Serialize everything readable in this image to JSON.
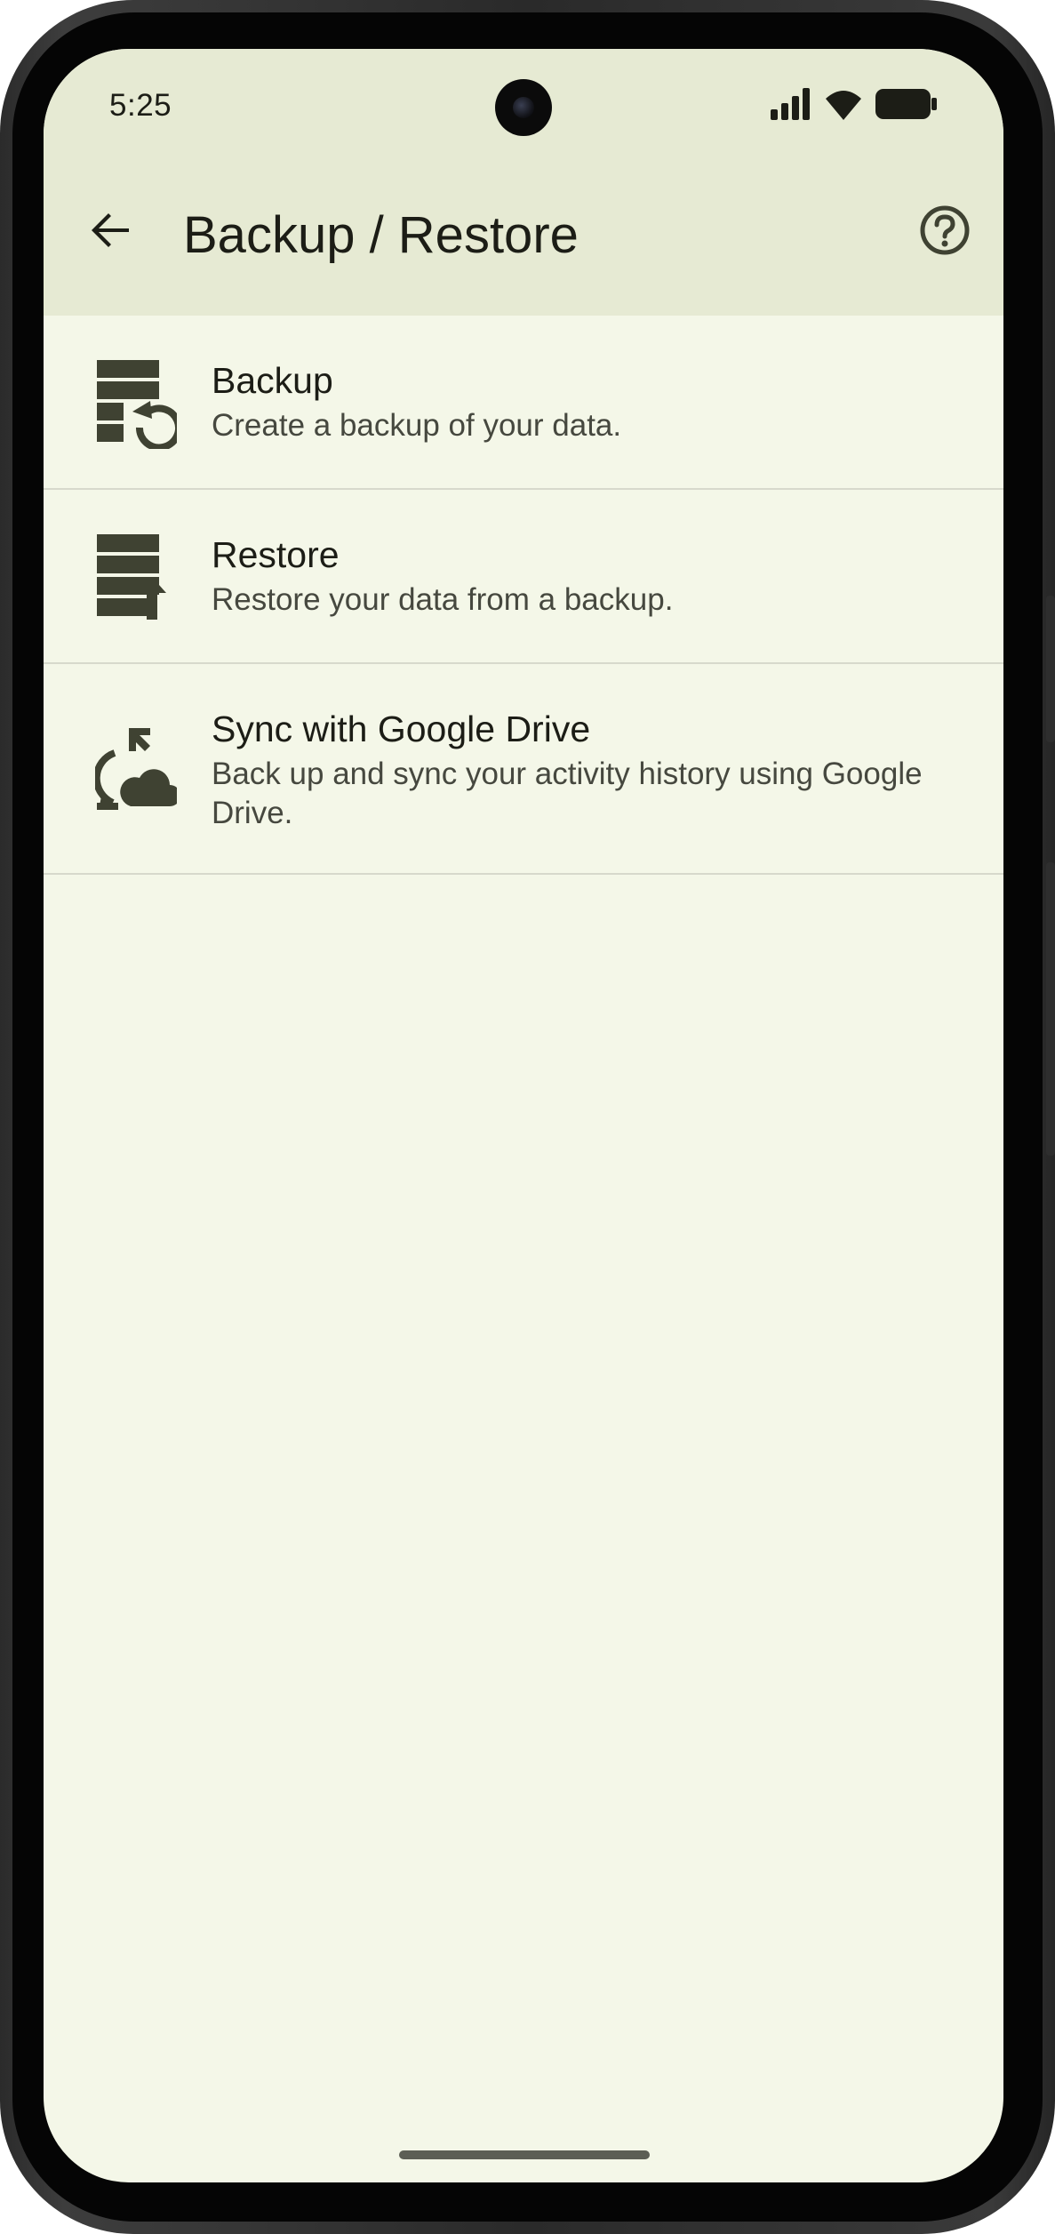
{
  "status_bar": {
    "time": "5:25",
    "icons": [
      "signal-icon",
      "wifi-icon",
      "battery-icon"
    ]
  },
  "app_bar": {
    "title": "Backup / Restore",
    "back_icon": "arrow-back-icon",
    "help_icon": "help-circle-icon"
  },
  "items": [
    {
      "title": "Backup",
      "subtitle": "Create a backup of your data.",
      "icon": "backup-storage-icon"
    },
    {
      "title": "Restore",
      "subtitle": "Restore your data from a backup.",
      "icon": "restore-storage-icon"
    },
    {
      "title": "Sync with Google Drive",
      "subtitle": "Back up and sync your activity history using Google Drive.",
      "icon": "cloud-sync-icon"
    }
  ],
  "colors": {
    "surface": "#f4f7e8",
    "top_surface": "#e6ead3",
    "icon": "#3f4232",
    "divider": "#d7d9cc",
    "text_primary": "#1c1d16",
    "text_secondary": "#46483f"
  }
}
